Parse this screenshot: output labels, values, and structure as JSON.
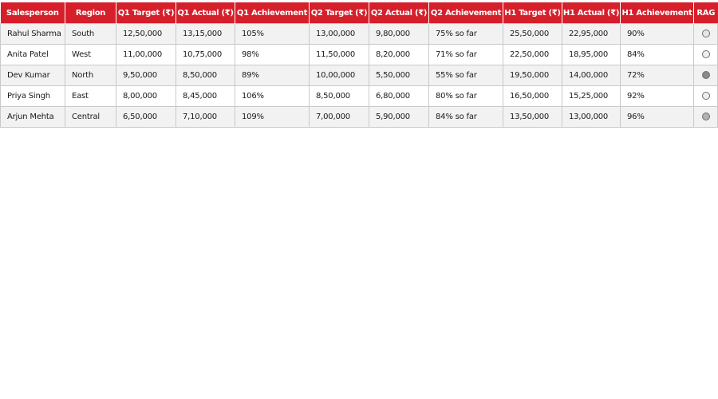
{
  "table": {
    "columns": [
      "Salesperson",
      "Region",
      "Q1 Target (₹)",
      "Q1 Actual (₹)",
      "Q1 Achievement",
      "Q2 Target (₹)",
      "Q2 Actual (₹)",
      "Q2 Achievement",
      "H1 Target (₹)",
      "H1 Actual (₹)",
      "H1 Achievement",
      "RAG"
    ],
    "rows": [
      {
        "salesperson": "Rahul Sharma",
        "region": "South",
        "q1_target": "12,50,000",
        "q1_actual": "13,15,000",
        "q1_achievement": "105%",
        "q2_target": "13,00,000",
        "q2_actual": "9,80,000",
        "q2_achievement": "75% so far",
        "h1_target": "25,50,000",
        "h1_actual": "22,95,000",
        "h1_achievement": "90%",
        "rag_color": "#e6e6e6"
      },
      {
        "salesperson": "Anita Patel",
        "region": "West",
        "q1_target": "11,00,000",
        "q1_actual": "10,75,000",
        "q1_achievement": "98%",
        "q2_target": "11,50,000",
        "q2_actual": "8,20,000",
        "q2_achievement": "71% so far",
        "h1_target": "22,50,000",
        "h1_actual": "18,95,000",
        "h1_achievement": "84%",
        "rag_color": "#eeeeee"
      },
      {
        "salesperson": "Dev Kumar",
        "region": "North",
        "q1_target": "9,50,000",
        "q1_actual": "8,50,000",
        "q1_achievement": "89%",
        "q2_target": "10,00,000",
        "q2_actual": "5,50,000",
        "q2_achievement": "55% so far",
        "h1_target": "19,50,000",
        "h1_actual": "14,00,000",
        "h1_achievement": "72%",
        "rag_color": "#8a8a8a"
      },
      {
        "salesperson": "Priya Singh",
        "region": "East",
        "q1_target": "8,00,000",
        "q1_actual": "8,45,000",
        "q1_achievement": "106%",
        "q2_target": "8,50,000",
        "q2_actual": "6,80,000",
        "q2_achievement": "80% so far",
        "h1_target": "16,50,000",
        "h1_actual": "15,25,000",
        "h1_achievement": "92%",
        "rag_color": "#eeeeee"
      },
      {
        "salesperson": "Arjun Mehta",
        "region": "Central",
        "q1_target": "6,50,000",
        "q1_actual": "7,10,000",
        "q1_achievement": "109%",
        "q2_target": "7,00,000",
        "q2_actual": "5,90,000",
        "q2_achievement": "84% so far",
        "h1_target": "13,50,000",
        "h1_actual": "13,00,000",
        "h1_achievement": "96%",
        "rag_color": "#b0b0b0"
      }
    ]
  },
  "colors": {
    "header_background": "#d51f2a",
    "header_text": "#ffffff",
    "row_stripe": "#f2f2f2",
    "grid_line": "#c9c9c9"
  }
}
